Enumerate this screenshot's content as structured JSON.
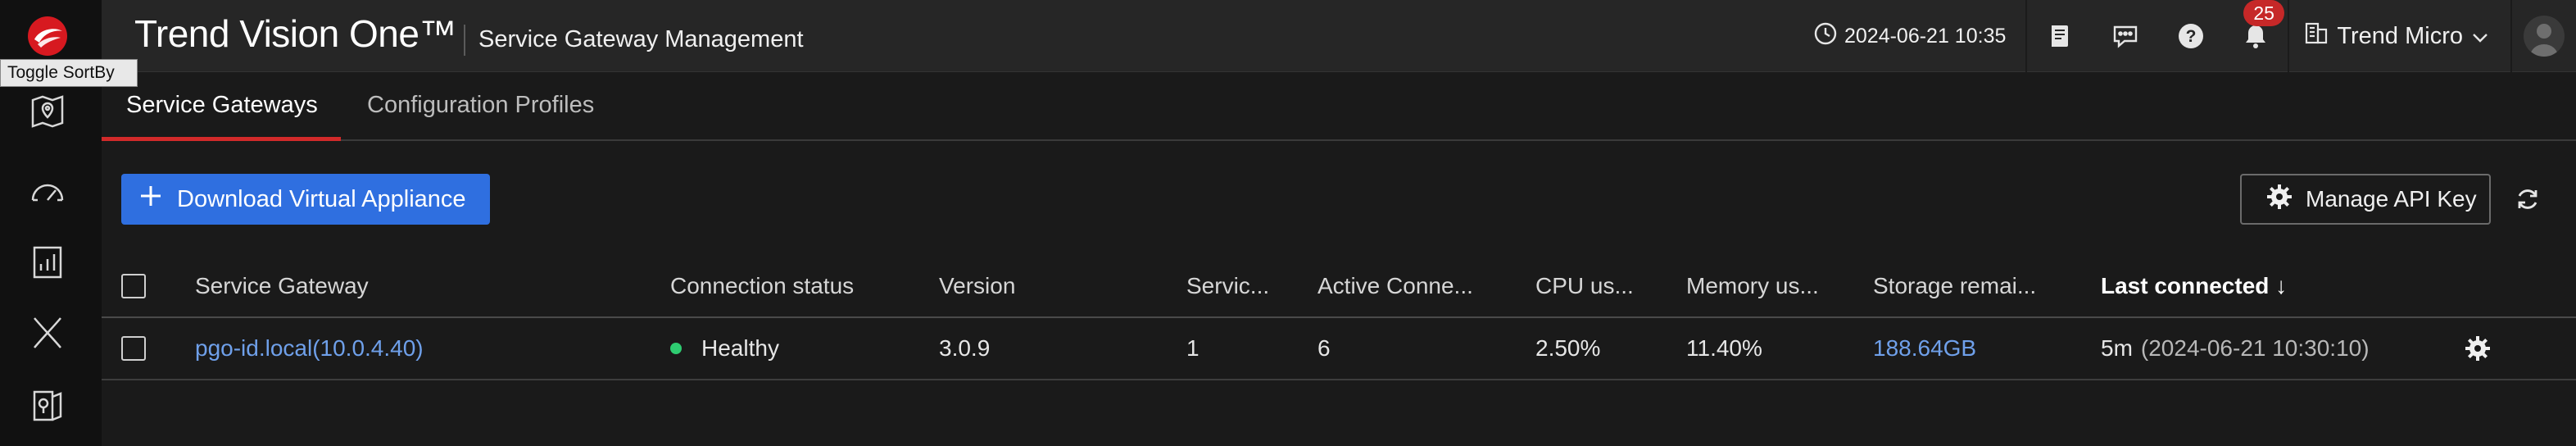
{
  "app": {
    "brand": "Trend Vision One™",
    "module_title": "Service Gateway Management"
  },
  "tooltip": "Toggle SortBy",
  "topbar": {
    "datetime": "2024-06-21 10:35",
    "notification_count": "25",
    "tenant_name": "Trend Micro"
  },
  "sidebar": {
    "items": [
      {
        "icon": "map-pin-icon"
      },
      {
        "icon": "speedometer-icon"
      },
      {
        "icon": "report-chart-icon"
      },
      {
        "icon": "xdr-icon"
      },
      {
        "icon": "map-document-icon"
      }
    ]
  },
  "tabs": [
    {
      "label": "Service Gateways",
      "active": true
    },
    {
      "label": "Configuration Profiles",
      "active": false
    }
  ],
  "actions": {
    "download_label": "Download Virtual Appliance",
    "manage_api_label": "Manage API Key"
  },
  "table": {
    "headers": {
      "gateway": "Service Gateway",
      "connection": "Connection status",
      "version": "Version",
      "services": "Servic...",
      "active_conn": "Active Conne...",
      "cpu": "CPU us...",
      "memory": "Memory us...",
      "storage": "Storage remai...",
      "last_connected": "Last connected ↓"
    },
    "rows": [
      {
        "gateway": "pgo-id.local(10.0.4.40)",
        "connection": "Healthy",
        "version": "3.0.9",
        "services": "1",
        "active_conn": "6",
        "cpu": "2.50%",
        "memory": "11.40%",
        "storage": "188.64GB",
        "last_connected_rel": "5m",
        "last_connected_abs": "(2024-06-21 10:30:10)"
      }
    ]
  },
  "colors": {
    "accent": "#2f6fe0",
    "brand_red": "#d22a2a",
    "healthy": "#2ecc71",
    "link": "#6fa0ea"
  }
}
